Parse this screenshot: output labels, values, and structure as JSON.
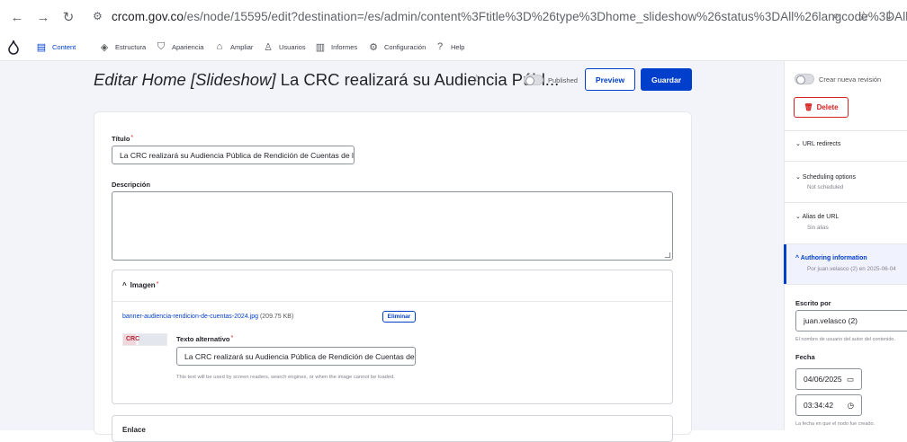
{
  "browser": {
    "url_host": "crcom.gov.co",
    "url_path": "/es/node/15595/edit?destination=/es/admin/content%3Ftitle%3D%26type%3Dhome_slideshow%26status%3DAll%26langcode%3DAll",
    "icons": [
      "back-arrow-icon",
      "forward-arrow-icon",
      "reload-icon",
      "site-settings-icon",
      "zoom-icon",
      "bookmark-star-icon",
      "download-icon"
    ]
  },
  "toolbar": {
    "items": [
      {
        "label": "Content",
        "icon": "content-icon"
      },
      {
        "label": "Estructura",
        "icon": "structure-icon"
      },
      {
        "label": "Apariencia",
        "icon": "appearance-icon"
      },
      {
        "label": "Ampliar",
        "icon": "extend-icon"
      },
      {
        "label": "Usuarios",
        "icon": "users-icon"
      },
      {
        "label": "Informes",
        "icon": "reports-icon"
      },
      {
        "label": "Configuración",
        "icon": "config-icon"
      },
      {
        "label": "Help",
        "icon": "help-icon"
      }
    ]
  },
  "header": {
    "title_prefix": "Editar Home [Slideshow]",
    "title_rest": " La CRC realizará su Audiencia Públ...",
    "published_label": "Published",
    "preview_label": "Preview",
    "save_label": "Guardar"
  },
  "form": {
    "title_label": "Título",
    "title_value": "La CRC realizará su Audiencia Pública de Rendición de Cuentas de la",
    "description_label": "Descripción",
    "description_value": "",
    "image": {
      "legend": "Imagen",
      "file_name": "banner-audiencia-rendicion-de-cuentas-2024.jpg",
      "file_size": "(209.75 KB)",
      "remove_label": "Eliminar",
      "alt_label": "Texto alternativo",
      "alt_value": "La CRC realizará su Audiencia Pública de Rendición de Cuentas de la",
      "alt_help": "This text will be used by screen readers, search engines, or when the image cannot be loaded.",
      "thumb_text": "CRC"
    },
    "link_legend": "Enlace"
  },
  "sidebar": {
    "revision_label": "Crear nueva revisión",
    "delete_label": "Delete",
    "sections": [
      {
        "title": "URL redirects",
        "sub": ""
      },
      {
        "title": "Scheduling options",
        "sub": "Not scheduled"
      },
      {
        "title": "Alias de URL",
        "sub": "Sin alias"
      },
      {
        "title": "Authoring information",
        "sub": "Por juan.velasco (2) en 2025-06-04"
      }
    ],
    "author_label": "Escrito por",
    "author_value": "juan.velasco (2)",
    "author_help": "El nombre de usuario del autor del contenido.",
    "date_label": "Fecha",
    "date_value": "04/06/2025",
    "time_value": "03:34:42",
    "date_help": "La fecha en que el nodo fue creado."
  }
}
